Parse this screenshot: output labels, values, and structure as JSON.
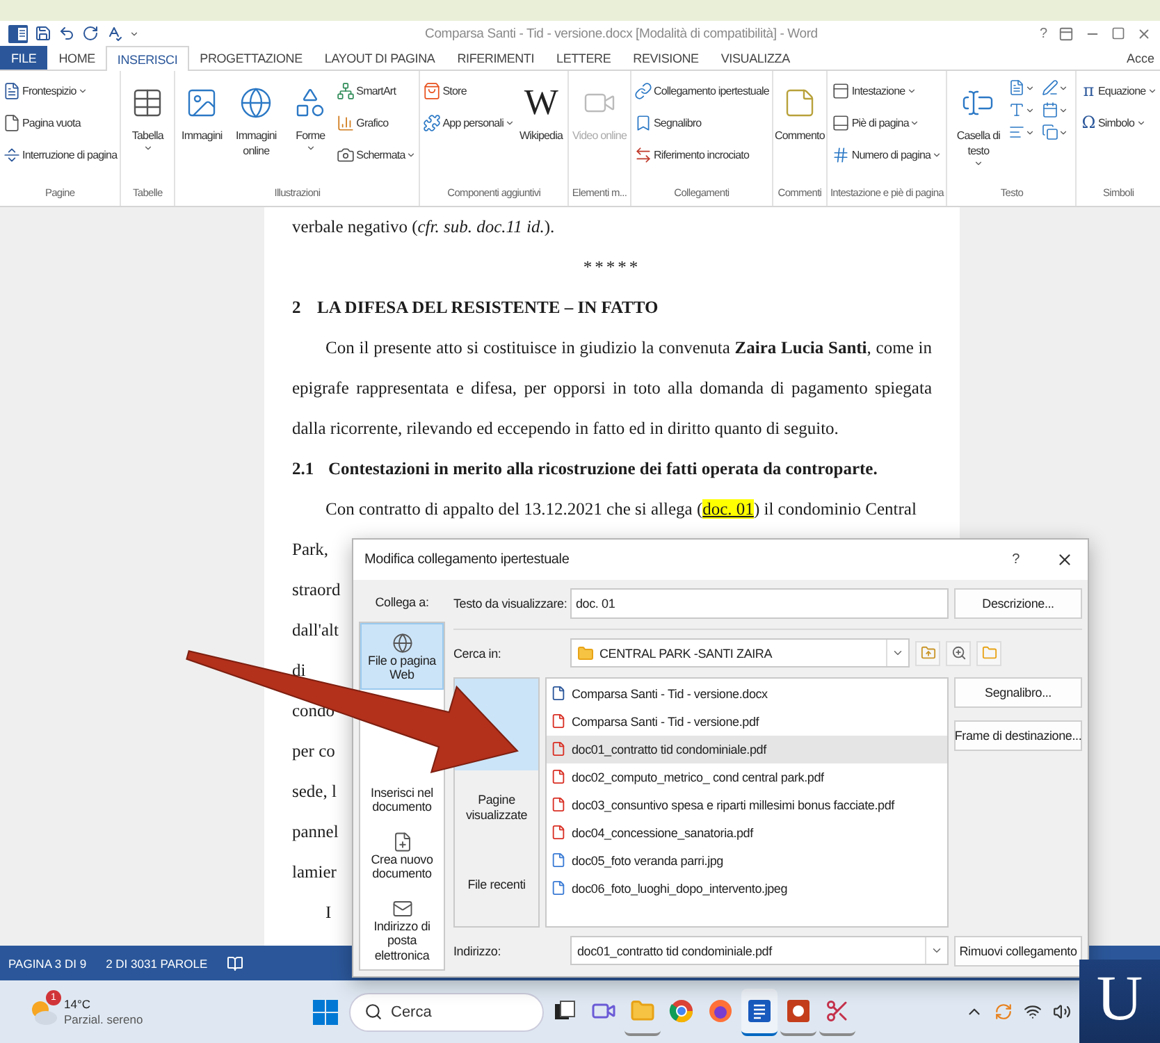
{
  "window": {
    "title": "Comparsa Santi - Tid - versione.docx [Modalità di compatibilità] - Word",
    "help": "?"
  },
  "tabs": [
    {
      "label": "FILE",
      "kind": "file",
      "selected": false
    },
    {
      "label": "HOME",
      "kind": "tab",
      "selected": false
    },
    {
      "label": "INSERISCI",
      "kind": "tab",
      "selected": true
    },
    {
      "label": "PROGETTAZIONE",
      "kind": "tab",
      "selected": false
    },
    {
      "label": "LAYOUT DI PAGINA",
      "kind": "tab",
      "selected": false
    },
    {
      "label": "RIFERIMENTI",
      "kind": "tab",
      "selected": false
    },
    {
      "label": "LETTERE",
      "kind": "tab",
      "selected": false
    },
    {
      "label": "REVISIONE",
      "kind": "tab",
      "selected": false
    },
    {
      "label": "VISUALIZZA",
      "kind": "tab",
      "selected": false
    }
  ],
  "account": "Acce",
  "ribbon": {
    "groups": [
      {
        "label": "Pagine",
        "items": [
          {
            "kind": "small",
            "label": "Frontespizio",
            "menu": true,
            "disabled": false
          },
          {
            "kind": "small",
            "label": "Pagina vuota",
            "menu": false,
            "disabled": false
          },
          {
            "kind": "small",
            "label": "Interruzione di pagina",
            "menu": false,
            "disabled": false
          }
        ]
      },
      {
        "label": "Tabelle",
        "items": [
          {
            "kind": "large",
            "label": "Tabella",
            "menu": true,
            "disabled": false
          }
        ]
      },
      {
        "label": "Illustrazioni",
        "items": [
          {
            "kind": "large",
            "label": "Immagini",
            "menu": false,
            "disabled": false
          },
          {
            "kind": "large",
            "label": "Immagini online",
            "menu": false,
            "disabled": false
          },
          {
            "kind": "large",
            "label": "Forme",
            "menu": true,
            "disabled": false
          },
          {
            "kind": "small",
            "label": "SmartArt",
            "menu": false,
            "disabled": false
          },
          {
            "kind": "small",
            "label": "Grafico",
            "menu": false,
            "disabled": false
          },
          {
            "kind": "small",
            "label": "Schermata",
            "menu": true,
            "disabled": false
          }
        ]
      },
      {
        "label": "Componenti aggiuntivi",
        "items": [
          {
            "kind": "small",
            "label": "Store",
            "menu": false,
            "disabled": false
          },
          {
            "kind": "small",
            "label": "App personali",
            "menu": true,
            "disabled": false
          },
          {
            "kind": "glyph_large",
            "glyph": "W",
            "label": "Wikipedia",
            "menu": false,
            "disabled": false
          }
        ]
      },
      {
        "label": "Elementi m...",
        "items": [
          {
            "kind": "large",
            "label": "Video online",
            "menu": false,
            "disabled": true
          }
        ]
      },
      {
        "label": "Collegamenti",
        "items": [
          {
            "kind": "small",
            "label": "Collegamento ipertestuale",
            "menu": false,
            "disabled": false
          },
          {
            "kind": "small",
            "label": "Segnalibro",
            "menu": false,
            "disabled": false
          },
          {
            "kind": "small",
            "label": "Riferimento incrociato",
            "menu": false,
            "disabled": false
          }
        ]
      },
      {
        "label": "Commenti",
        "items": [
          {
            "kind": "large",
            "label": "Commento",
            "menu": false,
            "disabled": false
          }
        ]
      },
      {
        "label": "Intestazione e piè di pagina",
        "items": [
          {
            "kind": "small",
            "label": "Intestazione",
            "menu": true,
            "disabled": false
          },
          {
            "kind": "small",
            "label": "Piè di pagina",
            "menu": true,
            "disabled": false
          },
          {
            "kind": "small",
            "label": "Numero di pagina",
            "menu": true,
            "disabled": false
          }
        ]
      },
      {
        "label": "Testo",
        "items": [
          {
            "kind": "large",
            "label": "Casella di testo",
            "menu": true,
            "disabled": false
          },
          {
            "kind": "grid",
            "menu": true,
            "disabled": false
          }
        ]
      },
      {
        "label": "Simboli",
        "items": [
          {
            "kind": "glyph_small",
            "glyph": "π",
            "label": "Equazione",
            "menu": true,
            "disabled": false
          },
          {
            "kind": "glyph_small",
            "glyph": "Ω",
            "label": "Simbolo",
            "menu": true,
            "disabled": false
          }
        ]
      }
    ]
  },
  "document": {
    "blocks": [
      {
        "kind": "text",
        "text": "verbale negativo (*cfr. sub. doc.11 id.*)."
      },
      {
        "kind": "separator",
        "text": "*****"
      },
      {
        "kind": "heading",
        "number": "2",
        "text": "LA DIFESA DEL RESISTENTE – IN FATTO"
      },
      {
        "kind": "paragraph",
        "text": "Con il presente atto si costituisce in giudizio la convenuta **Zaira Lucia Santi**, come in epigrafe rappresentata e difesa, per opporsi in toto alla domanda di pagamento spiegata dalla ricorrente, rilevando ed eccependo in fatto ed in diritto quanto di seguito."
      },
      {
        "kind": "heading",
        "number": "2.1",
        "text": "Contestazioni in merito alla ricostruzione dei fatti operata da controparte."
      },
      {
        "kind": "link_line",
        "before": "Con contratto di appalto del 13.12.2021 che si allega (",
        "link": "doc. 01",
        "after": ") il condominio Central"
      },
      {
        "kind": "fragment",
        "text": "Park,"
      },
      {
        "kind": "fragment",
        "text": "straord"
      },
      {
        "kind": "fragment",
        "text": "dall'alt"
      },
      {
        "kind": "fragment",
        "text": "di"
      },
      {
        "kind": "fragment",
        "text": "condo"
      },
      {
        "kind": "fragment",
        "text": "per co"
      },
      {
        "kind": "fragment",
        "text": "sede, l"
      },
      {
        "kind": "fragment",
        "text": "pannel"
      },
      {
        "kind": "fragment",
        "text": "lamier"
      },
      {
        "kind": "fragment_indent",
        "text": "I"
      }
    ]
  },
  "dialog": {
    "title": "Modifica collegamento ipertestuale",
    "help": "?",
    "link_to_label": "Collega a:",
    "link_targets": [
      {
        "label": "File o pagina Web",
        "selected": true
      },
      {
        "label": "Inserisci nel documento",
        "selected": false
      },
      {
        "label": "Crea nuovo documento",
        "selected": false
      },
      {
        "label": "Indirizzo di posta elettronica",
        "selected": false
      }
    ],
    "display_text_label": "Testo da visualizzare:",
    "display_text": "doc. 01",
    "description_button": "Descrizione...",
    "look_in_label": "Cerca in:",
    "look_in": "CENTRAL PARK -SANTI ZAIRA",
    "browse_sections": [
      {
        "selected": true
      },
      {
        "label": "Pagine visualizzate",
        "selected": false
      },
      {
        "label": "File recenti",
        "selected": false
      }
    ],
    "files": [
      {
        "name": "Comparsa Santi - Tid - versione.docx",
        "kind": "word",
        "selected": false
      },
      {
        "name": "Comparsa Santi - Tid - versione.pdf",
        "kind": "pdf",
        "selected": false
      },
      {
        "name": "doc01_contratto tid condominiale.pdf",
        "kind": "pdf",
        "selected": true
      },
      {
        "name": "doc02_computo_metrico_ cond central park.pdf",
        "kind": "pdf",
        "selected": false
      },
      {
        "name": "doc03_consuntivo spesa e riparti millesimi bonus facciate.pdf",
        "kind": "pdf",
        "selected": false
      },
      {
        "name": "doc04_concessione_sanatoria.pdf",
        "kind": "pdf",
        "selected": false
      },
      {
        "name": "doc05_foto veranda parri.jpg",
        "kind": "image",
        "selected": false
      },
      {
        "name": "doc06_foto_luoghi_dopo_intervento.jpeg",
        "kind": "image",
        "selected": false
      }
    ],
    "bookmark_button": "Segnalibro...",
    "target_frame_button": "Frame di destinazione...",
    "address_label": "Indirizzo:",
    "address": "doc01_contratto tid condominiale.pdf",
    "remove_link_button": "Rimuovi collegamento"
  },
  "status_bar": {
    "page": "PAGINA 3 DI 9",
    "words": "2 DI 3031 PAROLE"
  },
  "taskbar": {
    "weather": {
      "badge": "1",
      "temperature": "14°C",
      "condition": "Parzial. sereno"
    },
    "search": {
      "placeholder": "Cerca"
    },
    "apps": [
      {
        "running": false,
        "selected": false
      },
      {
        "running": false,
        "selected": false
      },
      {
        "running": true,
        "selected": false
      },
      {
        "running": false,
        "selected": false
      },
      {
        "running": false,
        "selected": false
      },
      {
        "running": true,
        "selected": true
      },
      {
        "running": true,
        "selected": false
      },
      {
        "running": true,
        "selected": false
      }
    ]
  },
  "logo": {
    "letter": "U"
  }
}
